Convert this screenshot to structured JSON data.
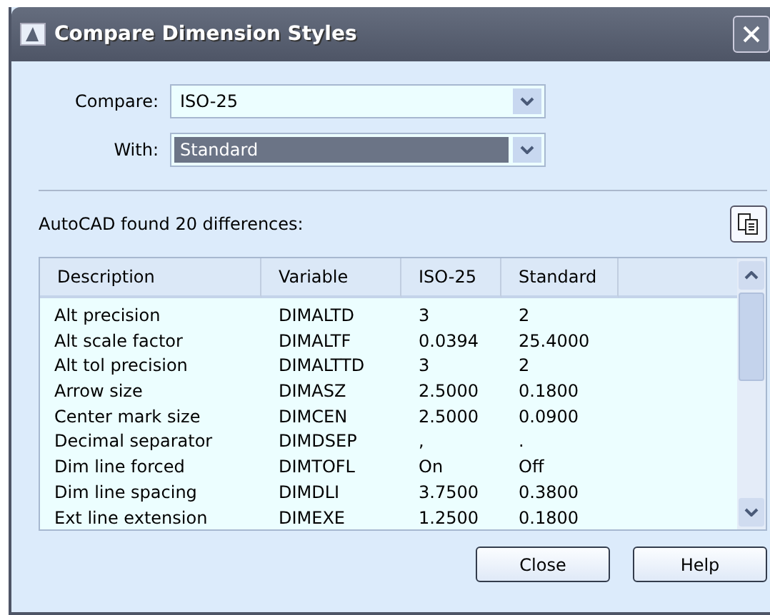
{
  "window": {
    "title": "Compare Dimension Styles"
  },
  "compare": {
    "label": "Compare:",
    "value": "ISO-25",
    "selected": false
  },
  "with": {
    "label": "With:",
    "value": "Standard",
    "selected": true
  },
  "summary": "AutoCAD found 20 differences:",
  "table": {
    "columns": [
      "Description",
      "Variable",
      "ISO-25",
      "Standard"
    ],
    "rows": [
      [
        "Alt precision",
        "DIMALTD",
        "3",
        "2"
      ],
      [
        "Alt scale factor",
        "DIMALTF",
        "0.0394",
        "25.4000"
      ],
      [
        "Alt tol precision",
        "DIMALTTD",
        "3",
        "2"
      ],
      [
        "Arrow size",
        "DIMASZ",
        "2.5000",
        "0.1800"
      ],
      [
        "Center mark size",
        "DIMCEN",
        "2.5000",
        "0.0900"
      ],
      [
        "Decimal separator",
        "DIMDSEP",
        ",",
        "."
      ],
      [
        "Dim line forced",
        "DIMTOFL",
        "On",
        "Off"
      ],
      [
        "Dim line spacing",
        "DIMDLI",
        "3.7500",
        "0.3800"
      ],
      [
        "Ext line extension",
        "DIMEXE",
        "1.2500",
        "0.1800"
      ]
    ]
  },
  "buttons": [
    "Close",
    "Help"
  ]
}
